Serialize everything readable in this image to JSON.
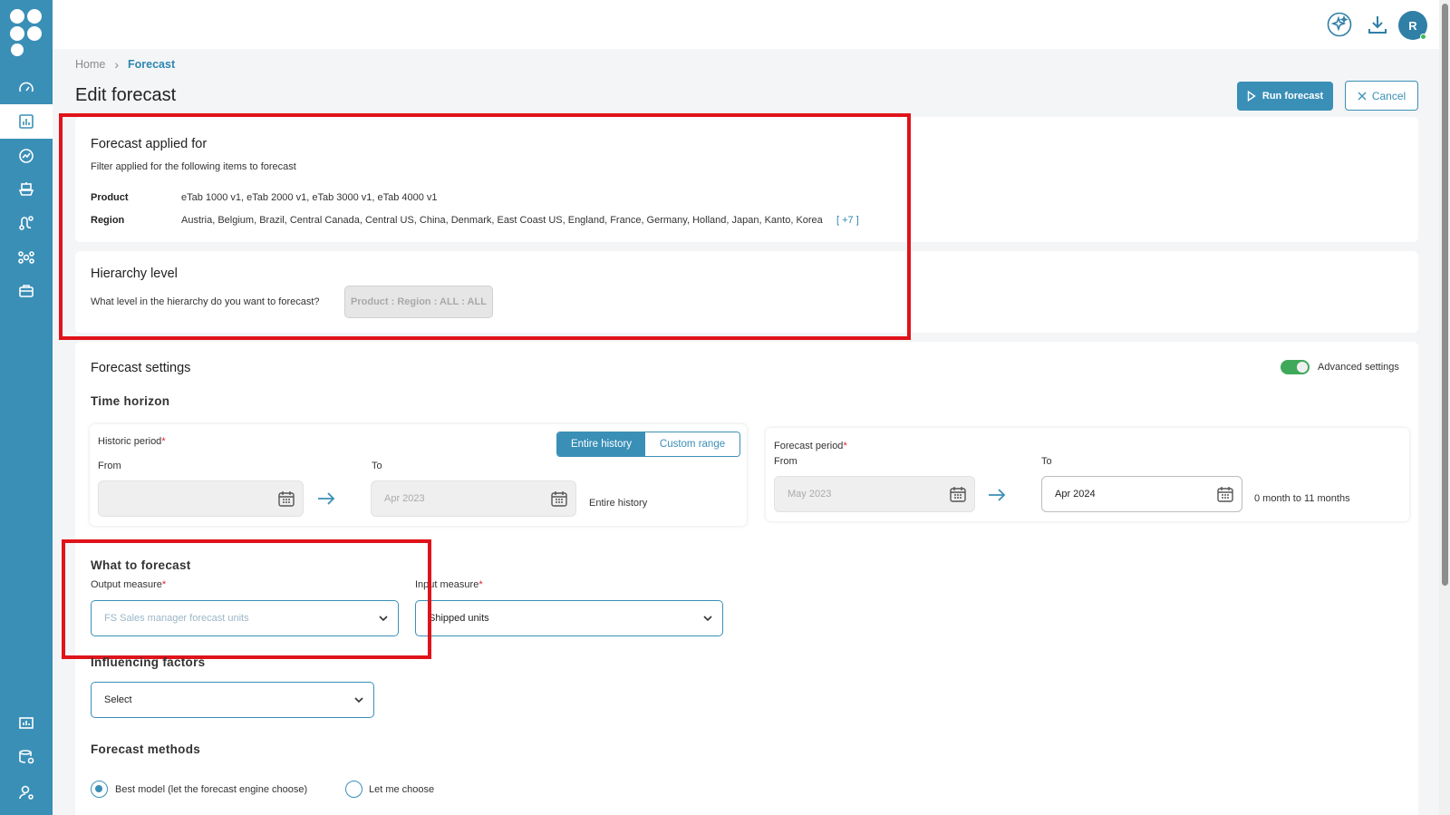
{
  "sidebar": {
    "nav_icons": [
      "gauge-icon",
      "bar-chart-icon",
      "trend-icon",
      "ship-icon",
      "route-icon",
      "network-icon",
      "briefcase-icon"
    ],
    "bottom_icons": [
      "report-icon",
      "database-settings-icon",
      "user-settings-icon"
    ],
    "active_index": 1,
    "accent": "#3a8fb7"
  },
  "topbar": {
    "icons": [
      "ai-sparkle-icon",
      "download-icon"
    ],
    "avatar_initial": "R"
  },
  "breadcrumb": {
    "home": "Home",
    "separator": "›",
    "current": "Forecast"
  },
  "page": {
    "title": "Edit forecast"
  },
  "actions": {
    "run_label": "Run forecast",
    "cancel_label": "Cancel"
  },
  "applied_for": {
    "title": "Forecast applied for",
    "subtitle": "Filter applied for the following items to forecast",
    "product_label": "Product",
    "product_value": "eTab 1000 v1, eTab 2000 v1, eTab 3000 v1, eTab 4000 v1",
    "region_label": "Region",
    "region_value": "Austria, Belgium, Brazil, Central Canada, Central US, China, Denmark, East Coast US, England, France, Germany, Holland, Japan, Kanto, Korea",
    "region_more": "[ +7 ]"
  },
  "hierarchy": {
    "title": "Hierarchy level",
    "question": "What level in the hierarchy do you want to forecast?",
    "value": "Product : Region : ALL : ALL"
  },
  "settings": {
    "title": "Forecast settings",
    "advanced_label": "Advanced settings",
    "advanced_on": true,
    "time_horizon_title": "Time horizon",
    "historic": {
      "label": "Historic period",
      "required_mark": "*",
      "seg_on": "Entire history",
      "seg_off": "Custom range",
      "from_label": "From",
      "to_label": "To",
      "from_value": "",
      "to_value": "Apr 2023",
      "summary": "Entire history"
    },
    "forecast_period": {
      "label": "Forecast period",
      "required_mark": "*",
      "from_label": "From",
      "to_label": "To",
      "from_value": "May 2023",
      "to_value": "Apr 2024",
      "summary": "0 month to 11 months"
    }
  },
  "what_to_forecast": {
    "title": "What to forecast",
    "output_label": "Output measure",
    "output_value": "FS Sales manager forecast units",
    "input_label": "Input measure",
    "input_value": "Shipped units",
    "required_mark": "*"
  },
  "influencing": {
    "title": "Influencing factors",
    "placeholder": "Select"
  },
  "methods": {
    "title": "Forecast methods",
    "options": [
      "Best model (let the forecast engine choose)",
      "Let me choose"
    ],
    "selected_index": 0
  }
}
